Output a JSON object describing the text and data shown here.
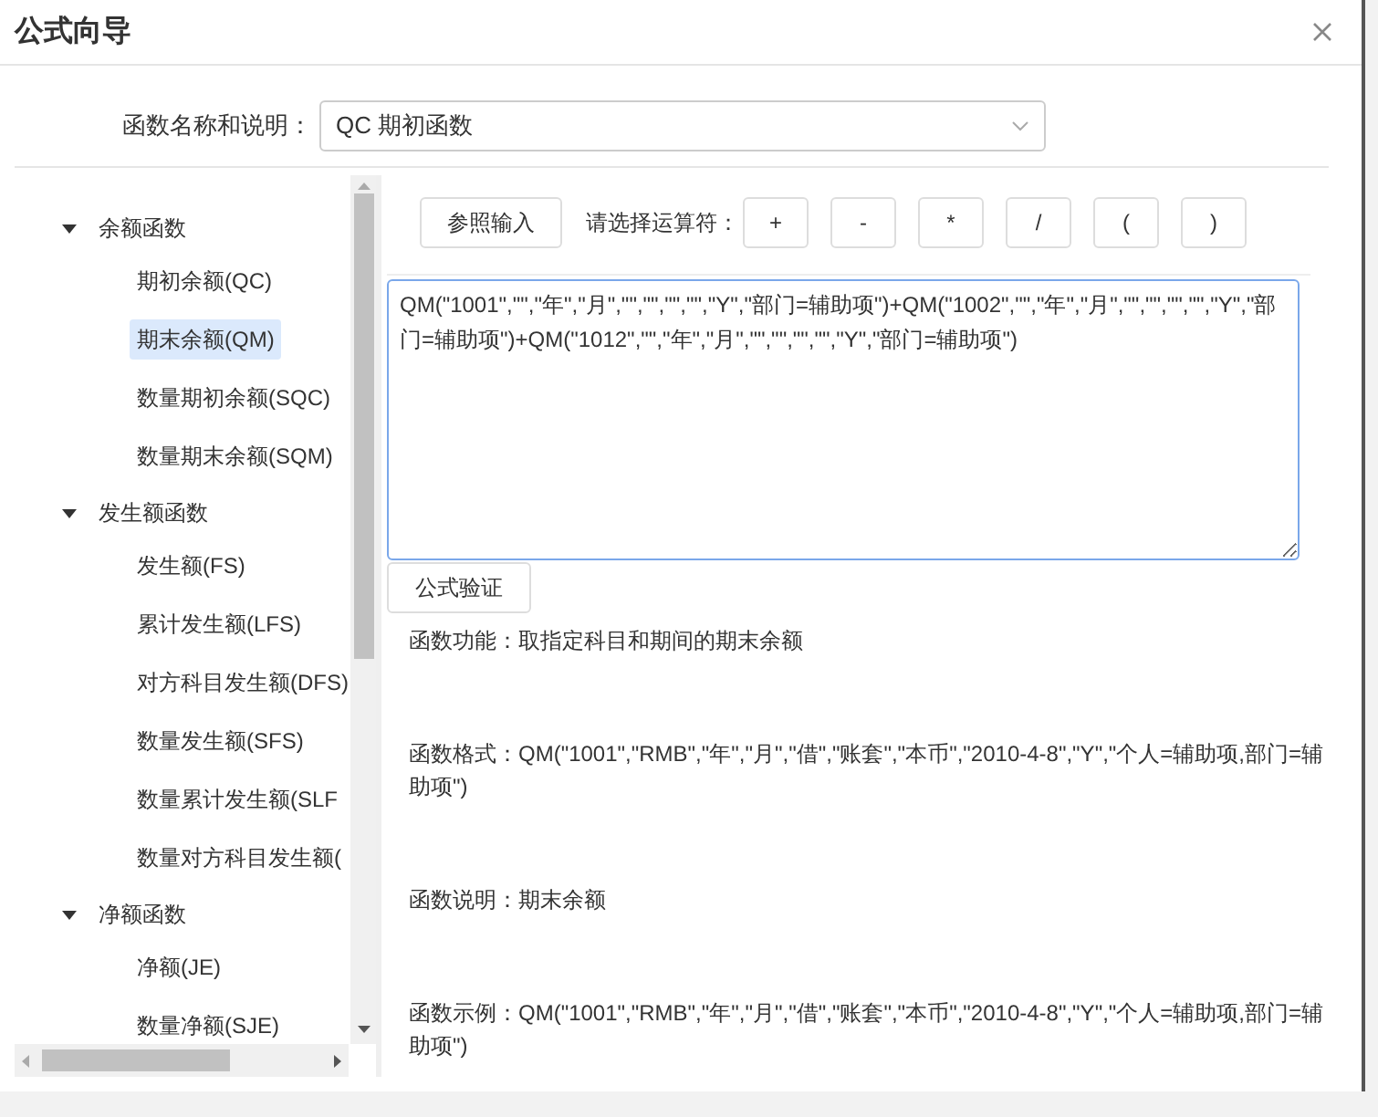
{
  "dialog": {
    "title": "公式向导"
  },
  "function_select": {
    "label": "函数名称和说明：",
    "value": "QC 期初函数"
  },
  "tree": [
    {
      "label": "余额函数",
      "expanded": true,
      "children": [
        {
          "label": "期初余额(QC)",
          "selected": false
        },
        {
          "label": "期末余额(QM)",
          "selected": true
        },
        {
          "label": "数量期初余额(SQC)",
          "selected": false
        },
        {
          "label": "数量期末余额(SQM)",
          "selected": false
        }
      ]
    },
    {
      "label": "发生额函数",
      "expanded": true,
      "children": [
        {
          "label": "发生额(FS)",
          "selected": false
        },
        {
          "label": "累计发生额(LFS)",
          "selected": false
        },
        {
          "label": "对方科目发生额(DFS)",
          "selected": false
        },
        {
          "label": "数量发生额(SFS)",
          "selected": false
        },
        {
          "label": "数量累计发生额(SLF",
          "selected": false
        },
        {
          "label": "数量对方科目发生额(",
          "selected": false
        }
      ]
    },
    {
      "label": "净额函数",
      "expanded": true,
      "children": [
        {
          "label": "净额(JE)",
          "selected": false
        },
        {
          "label": "数量净额(SJE)",
          "selected": false
        }
      ]
    }
  ],
  "toolbar": {
    "reference_button": "参照输入",
    "operator_label": "请选择运算符：",
    "operators": [
      "+",
      "-",
      "*",
      "/",
      "(",
      ")"
    ]
  },
  "formula": "QM(\"1001\",\"\",\"年\",\"月\",\"\",\"\",\"\",\"\",\"Y\",\"部门=辅助项\")+QM(\"1002\",\"\",\"年\",\"月\",\"\",\"\",\"\",\"\",\"Y\",\"部门=辅助项\")+QM(\"1012\",\"\",\"年\",\"月\",\"\",\"\",\"\",\"\",\"Y\",\"部门=辅助项\")",
  "verify_button": "公式验证",
  "descriptions": [
    "函数功能：取指定科目和期间的期末余额",
    "函数格式：QM(\"1001\",\"RMB\",\"年\",\"月\",\"借\",\"账套\",\"本币\",\"2010-4-8\",\"Y\",\"个人=辅助项,部门=辅助项\")",
    "函数说明：期末余额",
    "函数示例：QM(\"1001\",\"RMB\",\"年\",\"月\",\"借\",\"账套\",\"本币\",\"2010-4-8\",\"Y\",\"个人=辅助项,部门=辅助项\")"
  ]
}
